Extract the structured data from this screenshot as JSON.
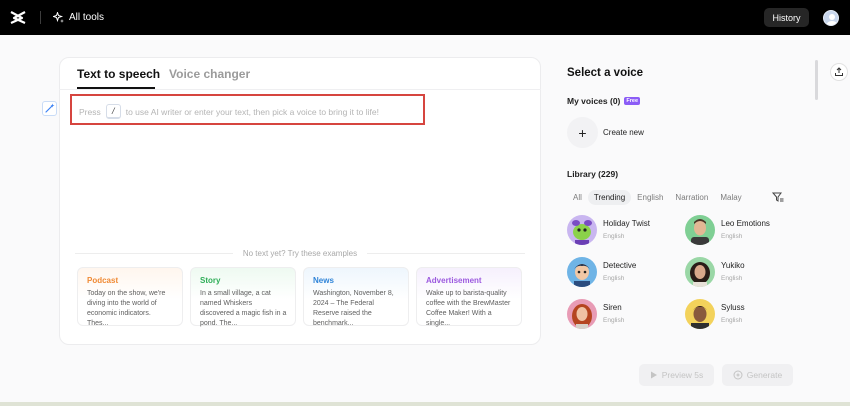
{
  "topbar": {
    "logo_icon": "capcut-logo-icon",
    "all_tools_label": "All tools",
    "all_tools_icon": "sparkle-icon",
    "history_label": "History"
  },
  "editor": {
    "tabs": [
      {
        "label": "Text to speech",
        "active": true
      },
      {
        "label": "Voice changer",
        "active": false
      }
    ],
    "placeholder_before": "Press",
    "placeholder_key": "/",
    "placeholder_after": "to use AI writer or enter your text, then pick a voice to bring it to life!",
    "examples_caption": "No text yet? Try these examples",
    "examples": [
      {
        "title": "Podcast",
        "text": "Today on the show, we're diving into the world of economic indicators. Thes..."
      },
      {
        "title": "Story",
        "text": "In a small village, a cat named Whiskers discovered a magic fish in a pond. The..."
      },
      {
        "title": "News",
        "text": "Washington, November 8, 2024 – The Federal Reserve raised the benchmark..."
      },
      {
        "title": "Advertisement",
        "text": "Wake up to barista-quality coffee with the BrewMaster Coffee Maker! With a single..."
      }
    ]
  },
  "voice_panel": {
    "title": "Select a voice",
    "my_voices_label": "My voices (0)",
    "free_badge": "Free",
    "create_new_label": "Create new",
    "library_label": "Library (229)",
    "filters": [
      "All",
      "Trending",
      "English",
      "Narration",
      "Malay"
    ],
    "active_filter": "Trending",
    "voices": [
      {
        "name": "Holiday Twist",
        "language": "English"
      },
      {
        "name": "Leo Emotions",
        "language": "English"
      },
      {
        "name": "Detective",
        "language": "English"
      },
      {
        "name": "Yukiko",
        "language": "English"
      },
      {
        "name": "Siren",
        "language": "English"
      },
      {
        "name": "Syluss",
        "language": "English"
      }
    ]
  },
  "actions": {
    "preview_label": "Preview 5s",
    "generate_label": "Generate"
  },
  "colors": {
    "highlight_box": "#d6453f",
    "podcast": "#f08a34",
    "story": "#2fae58",
    "news": "#2f84d8",
    "advertisement": "#9c59df",
    "free_badge": "#8b5cf6"
  }
}
